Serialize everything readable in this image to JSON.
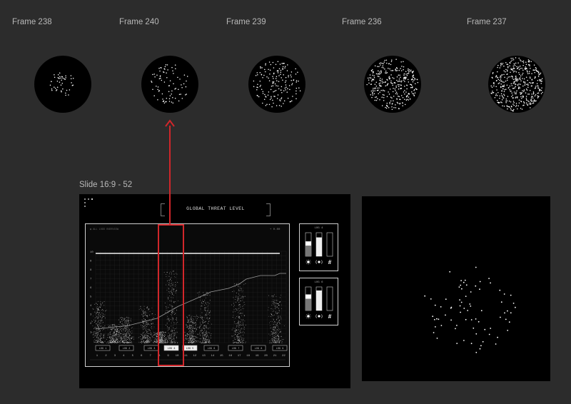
{
  "frames": [
    {
      "label": "Frame 238",
      "dots": 45
    },
    {
      "label": "Frame 240",
      "dots": 80
    },
    {
      "label": "Frame 239",
      "dots": 160
    },
    {
      "label": "Frame 236",
      "dots": 320
    },
    {
      "label": "Frame 237",
      "dots": 420
    }
  ],
  "slide": {
    "label": "Slide 16:9 - 52",
    "title": "GLOBAL THREAT LEVEL",
    "header_left": "◉ ALL LOGS OVERVIEW",
    "header_right": "+   0.00",
    "y_ticks": [
      "10",
      "9",
      "8",
      "7",
      "6",
      "5",
      "4",
      "3",
      "2",
      "1"
    ],
    "x_ticks": [
      "1",
      "2",
      "3",
      "4",
      "5",
      "6",
      "7",
      "8",
      "9",
      "10",
      "11",
      "12",
      "13",
      "14",
      "15",
      "16",
      "17",
      "18",
      "19",
      "20",
      "21",
      "22"
    ],
    "logs": [
      "LOG 1",
      "LOG 2",
      "LOG 3",
      "LOG 4",
      "LOG 5",
      "LOG 6",
      "LOG 7",
      "LOG 8",
      "LOG 9"
    ],
    "active_logs": [
      "LOG 4",
      "LOG 5"
    ],
    "side_panels": [
      {
        "label": "LOG 4",
        "bars": [
          0.45,
          0.8,
          0.0
        ]
      },
      {
        "label": "LOG 6",
        "bars": [
          0.5,
          0.85,
          0.0
        ]
      }
    ],
    "threshold": 10
  },
  "colors": {
    "canvas": "#2c2c2c",
    "artboard": "#000000",
    "highlight": "#d1262a",
    "foreground": "#ffffff"
  },
  "icons": [
    "sun-icon",
    "signal-icon",
    "hash-icon"
  ]
}
